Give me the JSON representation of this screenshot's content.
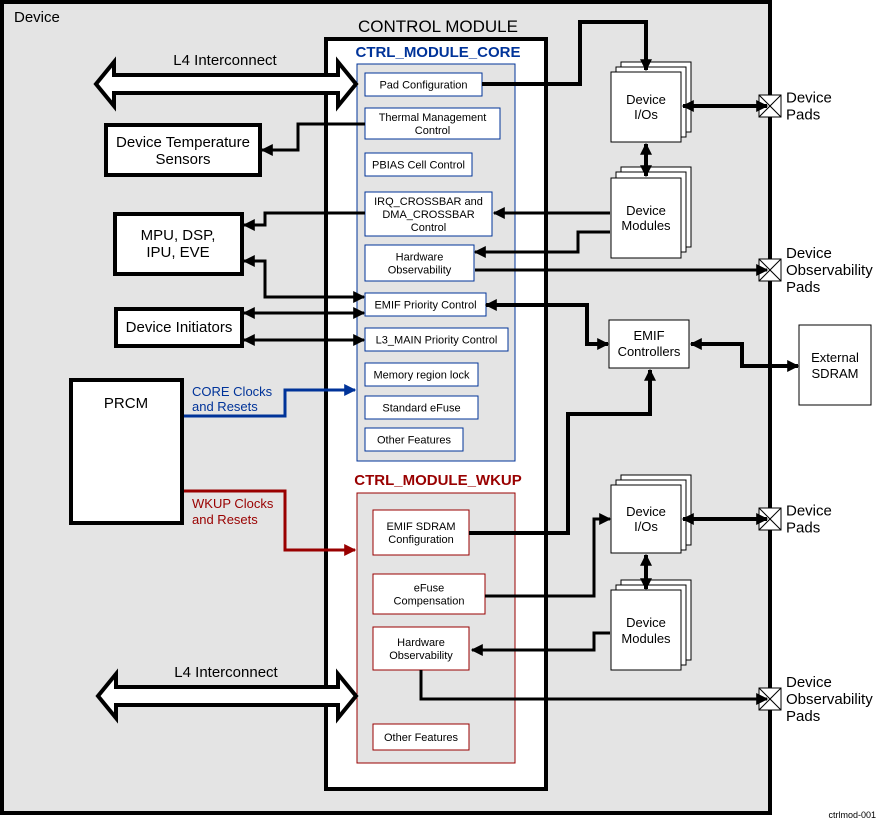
{
  "device_label": "Device",
  "control_module": {
    "title": "CONTROL MODULE",
    "core": {
      "title": "CTRL_MODULE_CORE",
      "blocks": [
        {
          "id": "pad-configuration",
          "lines": [
            "Pad Configuration"
          ]
        },
        {
          "id": "thermal-management-control",
          "lines": [
            "Thermal Management",
            "Control"
          ]
        },
        {
          "id": "pbias-cell-control",
          "lines": [
            "PBIAS Cell Control"
          ]
        },
        {
          "id": "irq-dma-crossbar-control",
          "lines": [
            "IRQ_CROSSBAR and",
            "DMA_CROSSBAR",
            "Control"
          ]
        },
        {
          "id": "hardware-observability-core",
          "lines": [
            "Hardware",
            "Observability"
          ]
        },
        {
          "id": "emif-priority-control",
          "lines": [
            "EMIF Priority Control"
          ]
        },
        {
          "id": "l3-main-priority-control",
          "lines": [
            "L3_MAIN Priority Control"
          ]
        },
        {
          "id": "memory-region-lock",
          "lines": [
            "Memory region lock"
          ]
        },
        {
          "id": "standard-efuse",
          "lines": [
            "Standard eFuse"
          ]
        },
        {
          "id": "other-features-core",
          "lines": [
            "Other Features"
          ]
        }
      ]
    },
    "wkup": {
      "title": "CTRL_MODULE_WKUP",
      "blocks": [
        {
          "id": "emif-sdram-configuration",
          "lines": [
            "EMIF SDRAM",
            "Configuration"
          ]
        },
        {
          "id": "efuse-compensation",
          "lines": [
            "eFuse",
            "Compensation"
          ]
        },
        {
          "id": "hardware-observability-wkup",
          "lines": [
            "Hardware",
            "Observability"
          ]
        },
        {
          "id": "other-features-wkup",
          "lines": [
            "Other Features"
          ]
        }
      ]
    }
  },
  "left_blocks": {
    "l4_top": "L4 Interconnect",
    "l4_bottom": "L4 Interconnect",
    "temp_sensors": [
      "Device Temperature",
      "Sensors"
    ],
    "mpu": [
      "MPU, DSP,",
      "IPU, EVE"
    ],
    "initiators": [
      "Device Initiators"
    ],
    "prcm": "PRCM",
    "core_clocks": [
      "CORE Clocks",
      "and Resets"
    ],
    "wkup_clocks": [
      "WKUP Clocks",
      "and Resets"
    ]
  },
  "right_blocks": {
    "device_ios": [
      "Device",
      "I/Os"
    ],
    "device_modules": [
      "Device",
      "Modules"
    ],
    "emif_controllers": [
      "EMIF",
      "Controllers"
    ],
    "external_sdram": [
      "External",
      "SDRAM"
    ],
    "device_pads": [
      "Device",
      "Pads"
    ],
    "device_obs_pads": [
      "Device",
      "Observability",
      "Pads"
    ]
  },
  "colors": {
    "core": "#003399",
    "wkup": "#990000",
    "device_bg": "#e4e4e4"
  },
  "figure_id": "ctrlmod-001"
}
